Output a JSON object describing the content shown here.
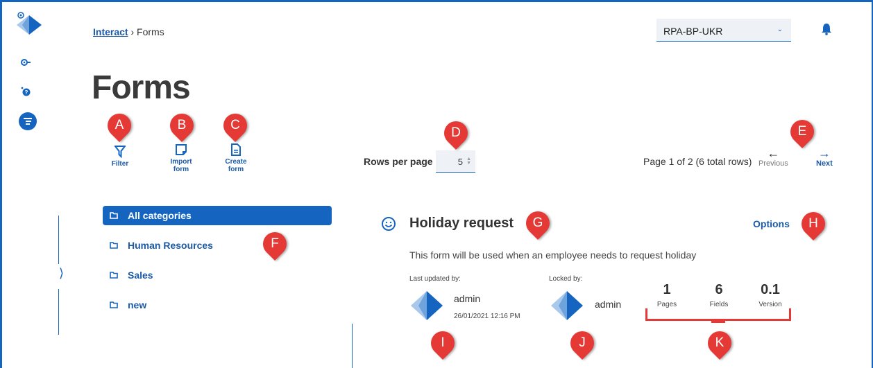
{
  "breadcrumb": {
    "root": "Interact",
    "separator": "›",
    "current": "Forms"
  },
  "environment": {
    "selected": "RPA-BP-UKR"
  },
  "page": {
    "title": "Forms"
  },
  "toolbar": {
    "filter_label": "Filter",
    "import_label": "Import form",
    "create_label": "Create form"
  },
  "pagination": {
    "rows_label": "Rows per page",
    "rows_value": "5",
    "page_info": "Page 1 of 2 (6 total rows)",
    "previous": "Previous",
    "next": "Next"
  },
  "categories": [
    {
      "label": "All categories",
      "active": true
    },
    {
      "label": "Human Resources",
      "active": false
    },
    {
      "label": "Sales",
      "active": false
    },
    {
      "label": "new",
      "active": false
    }
  ],
  "form": {
    "title": "Holiday request",
    "options": "Options",
    "description": "This form will be used when an employee needs to request holiday",
    "last_updated_label": "Last updated by:",
    "last_updated_user": "admin",
    "last_updated_date": "26/01/2021 12:16 PM",
    "locked_label": "Locked by:",
    "locked_user": "admin",
    "stats": [
      {
        "value": "1",
        "label": "Pages"
      },
      {
        "value": "6",
        "label": "Fields"
      },
      {
        "value": "0.1",
        "label": "Version"
      }
    ]
  },
  "markers": [
    "A",
    "B",
    "C",
    "D",
    "E",
    "F",
    "G",
    "H",
    "I",
    "J",
    "K"
  ],
  "colors": {
    "accent": "#1565c0",
    "marker": "#e53935",
    "link": "#1b5aa6"
  }
}
